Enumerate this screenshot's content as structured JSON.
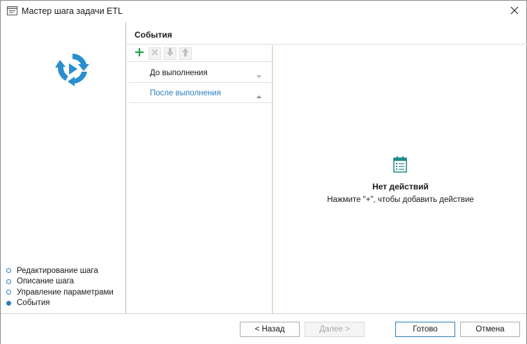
{
  "window": {
    "title": "Мастер шага задачи ETL",
    "icons": {
      "app": "window-icon",
      "close": "close-icon"
    }
  },
  "wizard": {
    "logo": "etl-cycle-icon",
    "steps": [
      {
        "label": "Редактирование шага",
        "active": false
      },
      {
        "label": "Описание шага",
        "active": false
      },
      {
        "label": "Управление параметрами",
        "active": false
      },
      {
        "label": "События",
        "active": true
      }
    ]
  },
  "content": {
    "title": "События",
    "toolbar": {
      "add": "plus-icon",
      "delete": "delete-icon",
      "move_down": "arrow-down-icon",
      "move_up": "arrow-up-icon"
    },
    "events": [
      {
        "label": "До выполнения",
        "selected": false,
        "chevron": "chevron-down-icon"
      },
      {
        "label": "После выполнения",
        "selected": true,
        "chevron": "chevron-up-icon"
      }
    ],
    "empty": {
      "icon": "calendar-list-icon",
      "title": "Нет действий",
      "hint": "Нажмите \"+\", чтобы добавить действие"
    }
  },
  "footer": {
    "back": "< Назад",
    "next": "Далее >",
    "ok": "Готово",
    "cancel": "Отмена"
  },
  "colors": {
    "accent": "#2b7fc1",
    "add_green": "#22a04a",
    "icon_teal": "#1e8a88"
  }
}
